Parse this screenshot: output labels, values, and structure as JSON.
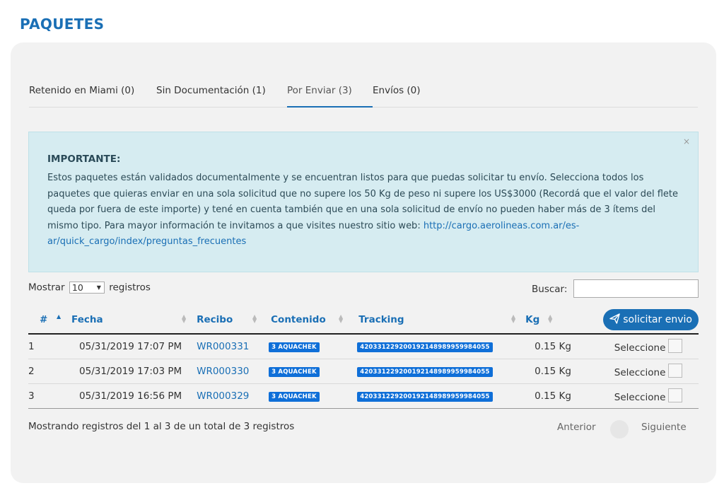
{
  "page": {
    "title": "PAQUETES"
  },
  "tabs": [
    {
      "label": "Retenido en Miami (0)"
    },
    {
      "label": "Sin Documentación (1)"
    },
    {
      "label": "Por Enviar (3)"
    },
    {
      "label": "Envíos (0)"
    }
  ],
  "alert": {
    "close": "×",
    "title": "IMPORTANTE:",
    "body": "Estos paquetes están validados documentalmente y se encuentran listos para que puedas solicitar tu envío. Selecciona todos los paquetes que quieras enviar en una sola solicitud que no supere los 50 Kg de peso ni supere los US$3000 (Recordá que el valor del flete queda por fuera de este importe) y tené en cuenta también que en una sola solicitud de envío no pueden haber más de 3 ítems del mismo tipo. Para mayor información te invitamos a que visites nuestro sitio web: ",
    "link": "http://cargo.aerolineas.com.ar/es-ar/quick_cargo/index/preguntas_frecuentes"
  },
  "length": {
    "prefix": "Mostrar",
    "value": "10",
    "suffix": "registros",
    "arrow": "▼"
  },
  "search": {
    "label": "Buscar:",
    "value": ""
  },
  "table": {
    "headers": {
      "num": "#",
      "fecha": "Fecha",
      "recibo": "Recibo",
      "contenido": "Contenido",
      "tracking": "Tracking",
      "kg": "Kg",
      "action": "solicitar envio"
    },
    "rows": [
      {
        "num": "1",
        "fecha": "05/31/2019 17:07 PM",
        "recibo": "WR000331",
        "contenido": "3 AQUACHEK",
        "tracking": "420331229200192148989959984055",
        "kg": "0.15 Kg",
        "select": "Seleccione"
      },
      {
        "num": "2",
        "fecha": "05/31/2019 17:03 PM",
        "recibo": "WR000330",
        "contenido": "3 AQUACHEK",
        "tracking": "420331229200192148989959984055",
        "kg": "0.15 Kg",
        "select": "Seleccione"
      },
      {
        "num": "3",
        "fecha": "05/31/2019 16:56 PM",
        "recibo": "WR000329",
        "contenido": "3 AQUACHEK",
        "tracking": "420331229200192148989959984055",
        "kg": "0.15 Kg",
        "select": "Seleccione"
      }
    ]
  },
  "footer": {
    "info": "Mostrando registros del 1 al 3 de un total de 3 registros",
    "prev": "Anterior",
    "next": "Siguiente"
  },
  "colors": {
    "accent": "#1a6fb5",
    "badge": "#0f6fd8",
    "alert_bg": "#d6ecf1",
    "panel_bg": "#f2f2f2"
  }
}
